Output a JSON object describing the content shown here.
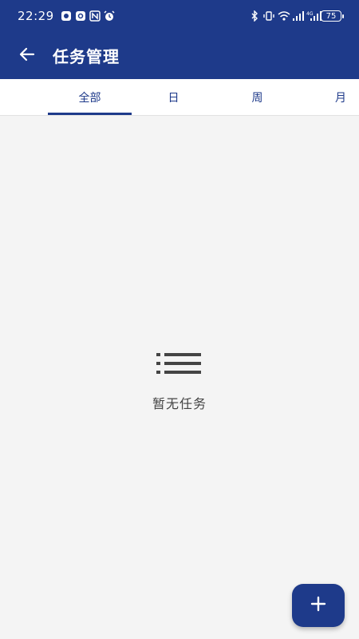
{
  "colors": {
    "primary": "#1e3a8a",
    "background": "#f4f4f4",
    "tab_bar": "#ffffff",
    "empty_text": "#444444"
  },
  "status_bar": {
    "time": "22:29",
    "battery": "75",
    "left_icons": [
      "app-notification-icon",
      "photo-notification-icon",
      "nfc-icon",
      "alarm-icon"
    ],
    "right_icons": [
      "bluetooth-icon",
      "vibrate-icon",
      "wifi-icon",
      "signal-icon",
      "signal-4g-icon"
    ]
  },
  "header": {
    "back_icon": "arrow-left-icon",
    "title": "任务管理"
  },
  "tabs": [
    {
      "label": "全部",
      "active": true
    },
    {
      "label": "日",
      "active": false
    },
    {
      "label": "周",
      "active": false
    },
    {
      "label": "月",
      "active": false
    }
  ],
  "empty_state": {
    "icon": "list-icon",
    "message": "暂无任务"
  },
  "fab": {
    "icon": "plus-icon"
  }
}
